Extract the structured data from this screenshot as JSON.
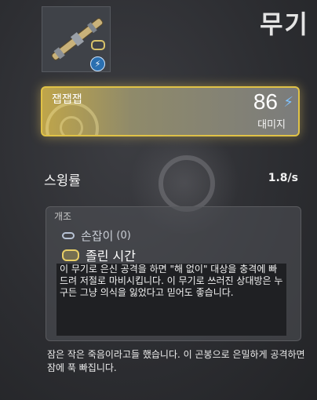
{
  "header": {
    "title": "무기"
  },
  "weapon": {
    "element_icon": "electric-bolt-icon",
    "accent": "#e0c247"
  },
  "damage": {
    "name": "잽잽잽",
    "value": "86",
    "label": "대미지",
    "icon": "electric-bolt-icon"
  },
  "stats": [
    {
      "label": "스윙률",
      "value": "1.8/s"
    }
  ],
  "mods": {
    "header": "개조",
    "items": [
      {
        "name": "손잡이",
        "count": "(0)"
      },
      {
        "name": "졸린 시간",
        "description": "이 무기로 은신 공격을 하면 \"해 없이\" 대상을 충격에 빠드려 저절로 마비시킵니다. 이 무기로 쓰러진 상대방은 누구든 그냥 의식을 잃었다고 믿어도 좋습니다."
      }
    ]
  },
  "flavor": "잠은 작은 죽음이라고들 했습니다. 이 곤봉으로 은밀하게 공격하면 잠에 푹 빠집니다."
}
